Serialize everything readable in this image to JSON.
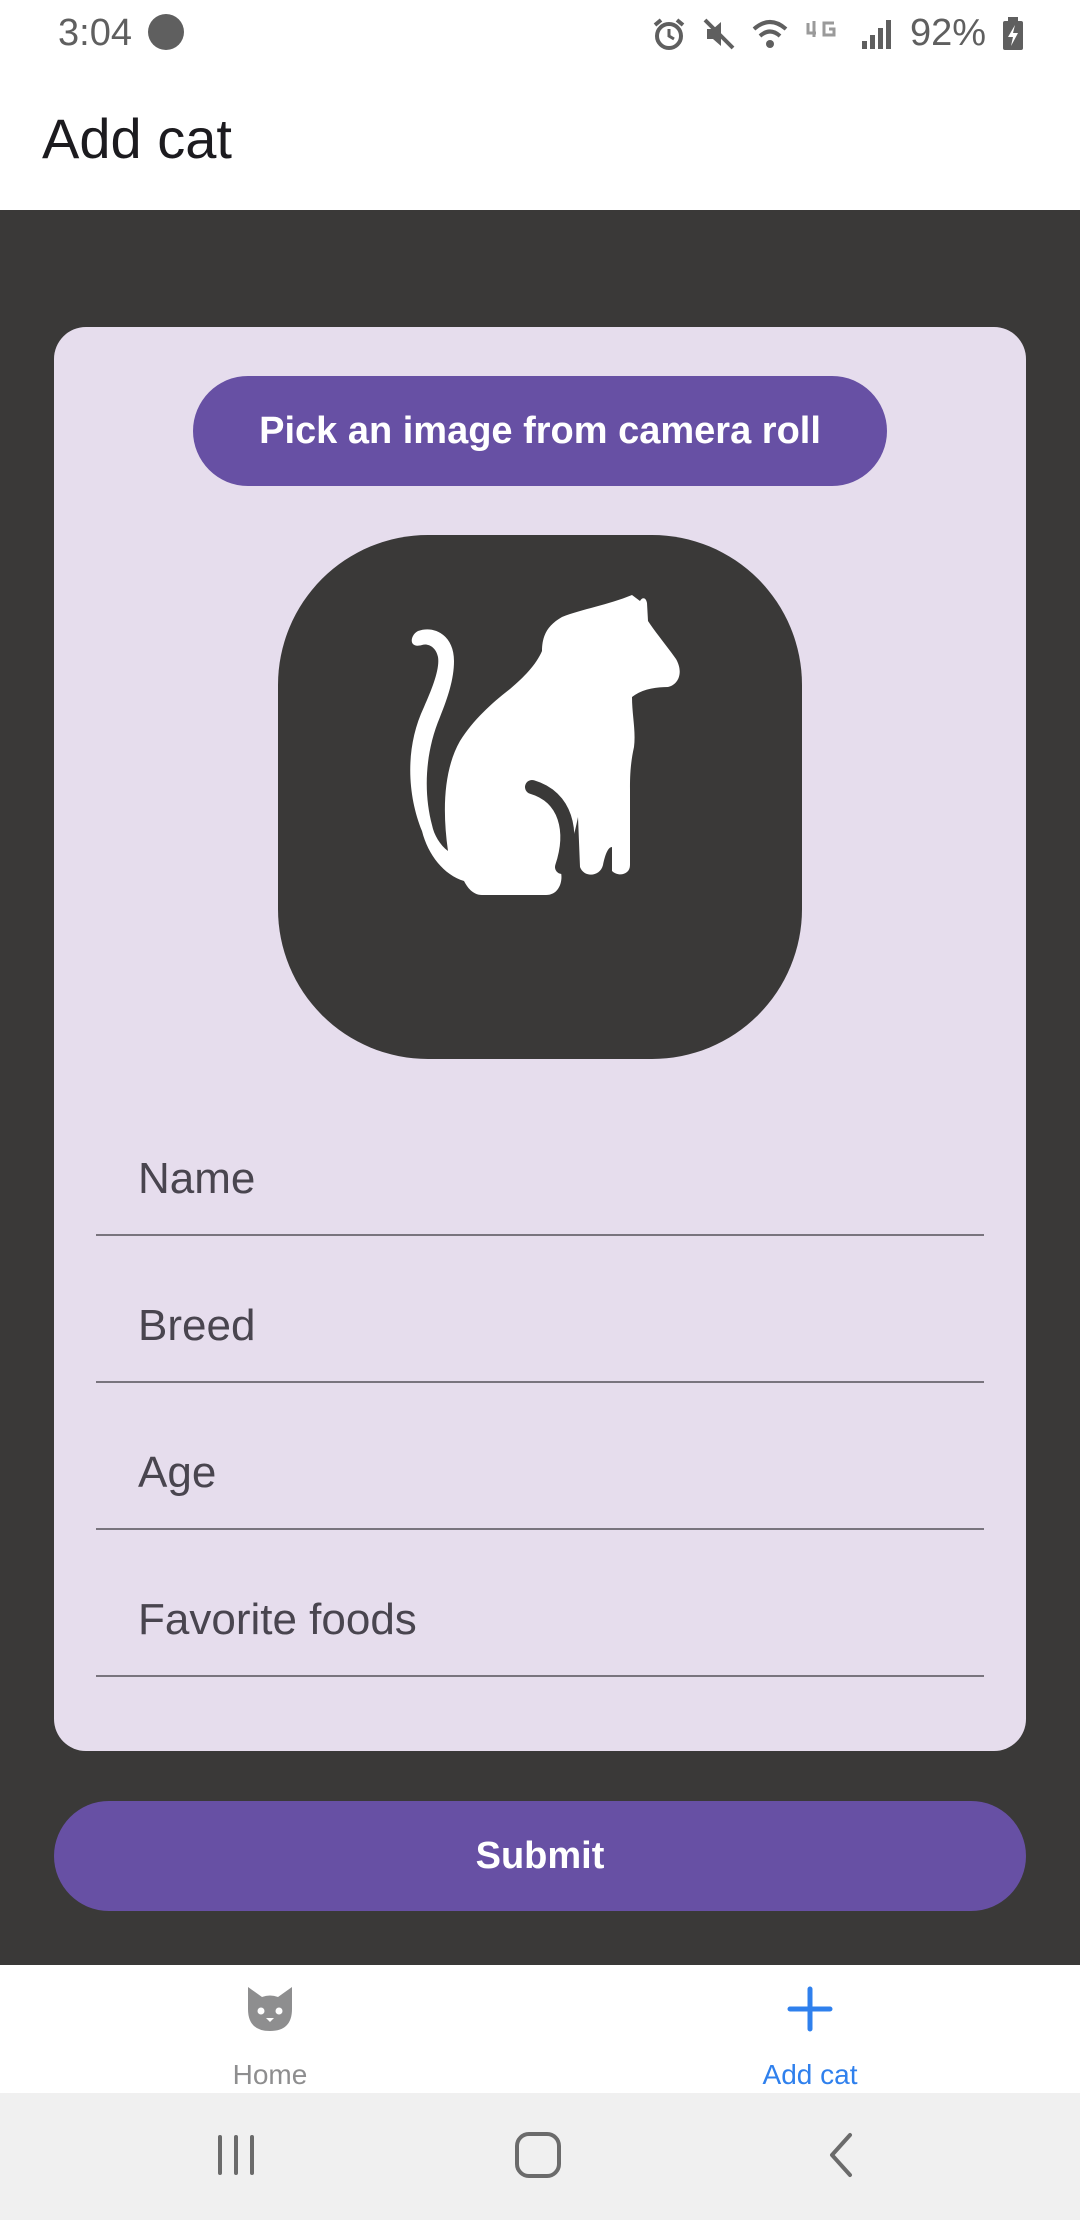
{
  "status_bar": {
    "time": "3:04",
    "battery": "92%"
  },
  "header": {
    "title": "Add cat"
  },
  "form": {
    "pick_image_label": "Pick an image from camera roll",
    "fields": [
      {
        "label": "Name"
      },
      {
        "label": "Breed"
      },
      {
        "label": "Age"
      },
      {
        "label": "Favorite foods"
      }
    ],
    "submit_label": "Submit"
  },
  "tabs": [
    {
      "label": "Home",
      "icon": "cat-face-icon",
      "active": false
    },
    {
      "label": "Add cat",
      "icon": "plus-icon",
      "active": true
    }
  ],
  "colors": {
    "accent": "#6750a4",
    "card": "#e6dded",
    "background": "#3a3938",
    "tab_active": "#2f80ed"
  }
}
